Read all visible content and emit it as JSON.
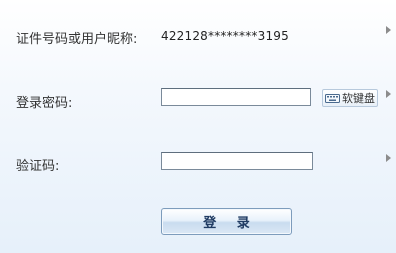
{
  "form": {
    "account": {
      "label": "证件号码或用户昵称:",
      "value": "422128********3195"
    },
    "password": {
      "label": "登录密码:",
      "value": "",
      "keyboard_label": "软键盘"
    },
    "captcha": {
      "label": "验证码:",
      "value": ""
    },
    "login_label": "登 录"
  },
  "icons": {
    "row_arrow": "triangle-right-icon",
    "keyboard": "keyboard-icon"
  },
  "colors": {
    "background_top": "#ffffff",
    "background_bottom": "#e6f0fa",
    "button_text": "#1f3b63",
    "button_border": "#7d9cbc",
    "arrow": "#8c8c8c"
  }
}
